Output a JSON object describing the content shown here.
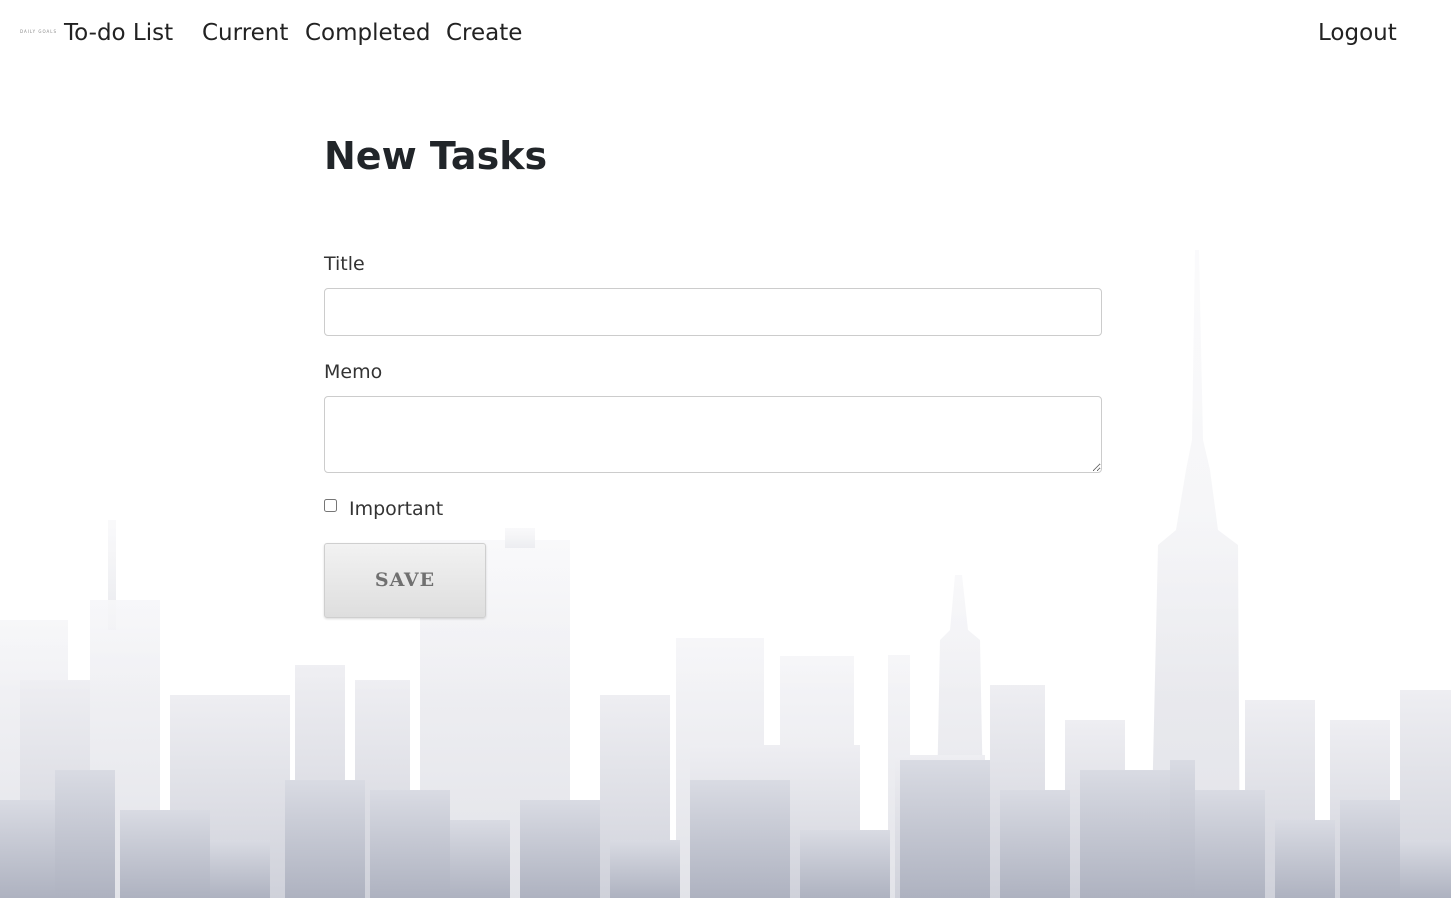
{
  "navbar": {
    "logo_text": "DAILY GOALS",
    "brand": "To-do List",
    "links": {
      "current": "Current",
      "completed": "Completed",
      "create": "Create",
      "logout": "Logout"
    }
  },
  "form": {
    "heading": "New Tasks",
    "title_label": "Title",
    "title_value": "",
    "memo_label": "Memo",
    "memo_value": "",
    "important_label": "Important",
    "important_checked": false,
    "save_label": "SAVE"
  },
  "colors": {
    "text": "#212529",
    "skyline": "#a9aebd",
    "button_text": "#707070"
  }
}
